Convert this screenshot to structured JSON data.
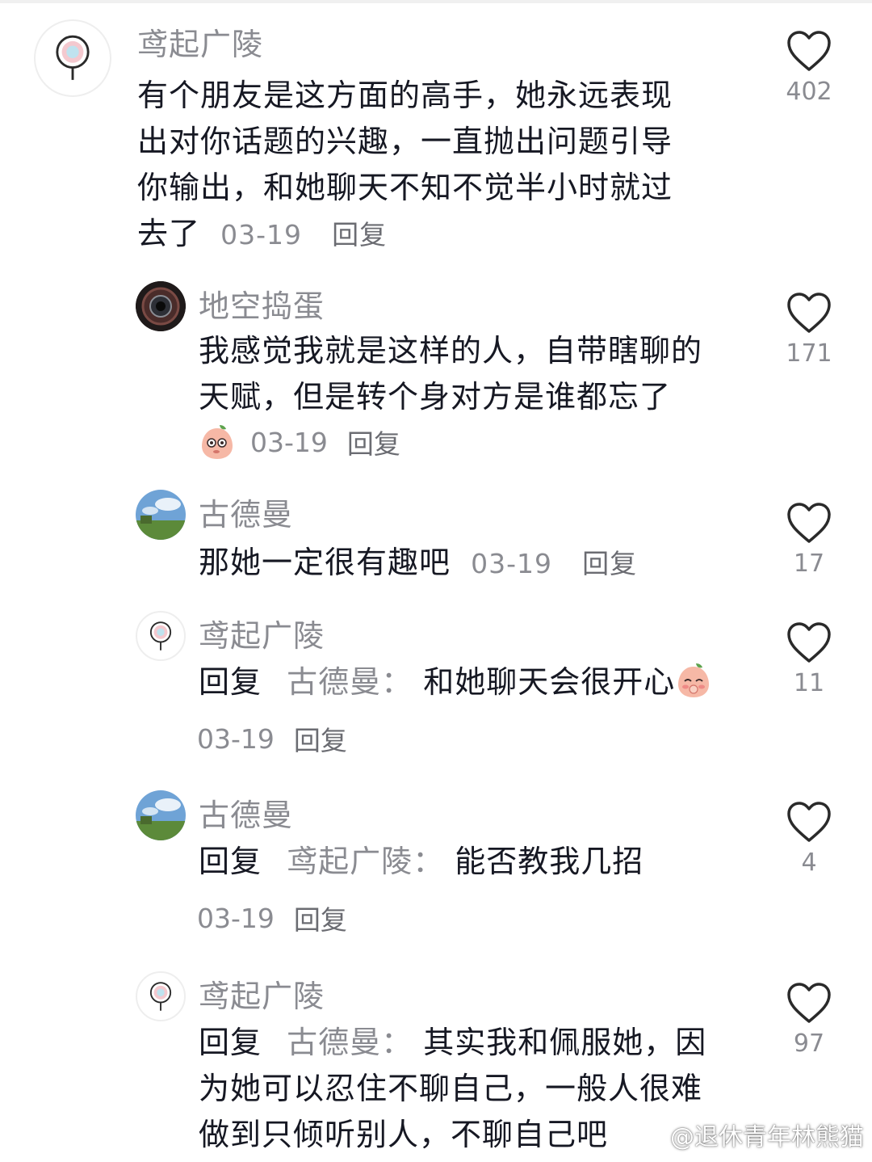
{
  "comments": [
    {
      "username": "鸢起广陵",
      "text": "有个朋友是这方面的高手，她永远表现出对你话题的兴趣，一直抛出问题引导你输出，和她聊天不知不觉半小时就过去了",
      "text_lines": [
        "有个朋友是这方面的高手，她永远表现",
        "出对你话题的兴趣，一直抛出问题引导",
        "你输出，和她聊天不知不觉半小时就过",
        "去了"
      ],
      "date": "03-19",
      "reply_label": "回复",
      "likes": "402",
      "avatar": "lollipop-avatar"
    },
    {
      "username": "地空捣蛋",
      "text_lines": [
        "我感觉我就是这样的人，自带瞎聊的",
        "天赋，但是转个身对方是谁都忘了"
      ],
      "emoji": "peach-thinking-emoji",
      "date": "03-19",
      "reply_label": "回复",
      "likes": "171",
      "avatar": "dark-lens-avatar"
    },
    {
      "username": "古德曼",
      "text": "那她一定很有趣吧",
      "date": "03-19",
      "reply_label": "回复",
      "likes": "17",
      "avatar": "landscape-avatar"
    },
    {
      "username": "鸢起广陵",
      "reply_prefix": "回复",
      "reply_target": "古德曼：",
      "text": "和她聊天会很开心",
      "emoji": "peach-shy-emoji",
      "date": "03-19",
      "reply_label": "回复",
      "likes": "11",
      "avatar": "lollipop-avatar"
    },
    {
      "username": "古德曼",
      "reply_prefix": "回复",
      "reply_target": "鸢起广陵：",
      "text": "能否教我几招",
      "date": "03-19",
      "reply_label": "回复",
      "likes": "4",
      "avatar": "landscape-avatar"
    },
    {
      "username": "鸢起广陵",
      "reply_prefix": "回复",
      "reply_target": "古德曼：",
      "text_lines": [
        "其实我和佩服她，因",
        "为她可以忍住不聊自己，一般人很难",
        "做到只倾听别人，不聊自己吧"
      ],
      "likes": "97",
      "avatar": "lollipop-avatar"
    }
  ],
  "watermark": {
    "text": "@退休青年林熊猫",
    "icon": "weibo-icon"
  },
  "colors": {
    "text": "#161823",
    "muted": "#8a8b91",
    "background": "#ffffff"
  }
}
